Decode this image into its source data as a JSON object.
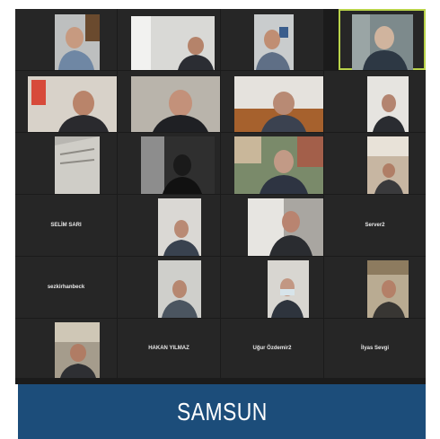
{
  "meeting": {
    "name_labels": [
      "SELİM SARI",
      "Server2",
      "sezkirhanbeck",
      "HAKAN YILMAZ",
      "Uğur Özdemir2",
      "İlyas Sevgi"
    ]
  },
  "caption": {
    "text": "SAMSUN"
  },
  "colors": {
    "caption_bg": "#1c4d7a",
    "active_speaker_border": "#b9d34a",
    "gallery_bg": "#1b1b1b"
  }
}
